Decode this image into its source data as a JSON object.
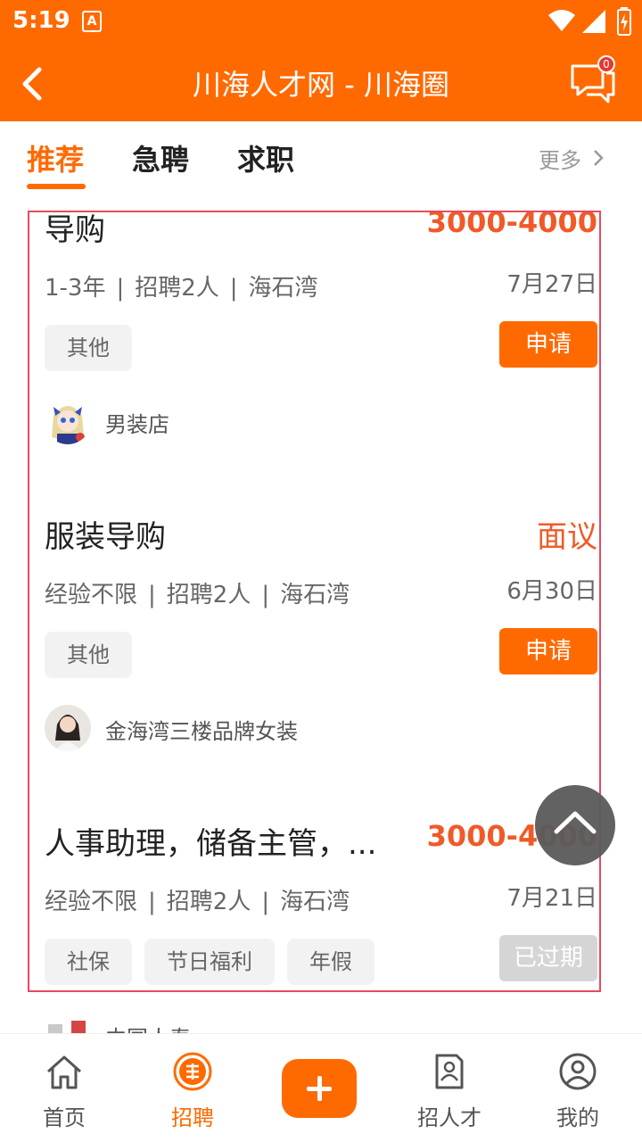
{
  "status_bar": {
    "time": "5:19",
    "notification_glyph": "A"
  },
  "navbar": {
    "title": "川海人才网 - 川海圈",
    "message_badge": "0"
  },
  "tabs": [
    {
      "label": "推荐",
      "active": true
    },
    {
      "label": "急聘",
      "active": false
    },
    {
      "label": "求职",
      "active": false
    }
  ],
  "more_label": "更多",
  "jobs": [
    {
      "title": "导购",
      "salary": "3000-4000",
      "experience": "1-3年",
      "headcount": "招聘2人",
      "location": "海石湾",
      "date": "7月27日",
      "tags": [
        "其他"
      ],
      "action": "申请",
      "company": "男装店"
    },
    {
      "title": "服装导购",
      "salary": "面议",
      "experience": "经验不限",
      "headcount": "招聘2人",
      "location": "海石湾",
      "date": "6月30日",
      "tags": [
        "其他"
      ],
      "action": "申请",
      "company": "金海湾三楼品牌女装"
    },
    {
      "title": "人事助理，储备主管，...",
      "salary": "3000-4000",
      "experience": "经验不限",
      "headcount": "招聘2人",
      "location": "海石湾",
      "date": "7月21日",
      "tags": [
        "社保",
        "节日福利",
        "年假"
      ],
      "action": "已过期",
      "company": "中国人寿"
    }
  ],
  "meta_separator": "|",
  "bottom_tabs": [
    {
      "label": "首页",
      "icon": "home-icon",
      "active": false
    },
    {
      "label": "招聘",
      "icon": "recruit-icon",
      "active": true
    },
    {
      "label": "招人才",
      "icon": "resume-icon",
      "active": false
    },
    {
      "label": "我的",
      "icon": "profile-icon",
      "active": false
    }
  ],
  "colors": {
    "brand": "#ff6a00",
    "salary": "#f05a28",
    "expired": "#d5d5d5",
    "highlight_border": "#e84a5f"
  }
}
